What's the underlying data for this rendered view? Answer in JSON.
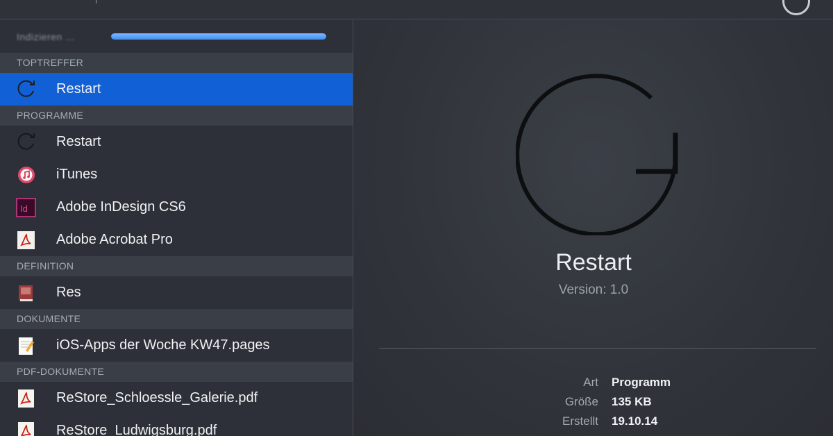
{
  "search": {
    "query": ""
  },
  "indexing": {
    "label": "Indizieren …",
    "progress_percent": 100
  },
  "sections": {
    "top_hits": "TOPTREFFER",
    "programs": "PROGRAMME",
    "definition": "DEFINITION",
    "documents": "DOKUMENTE",
    "pdf_documents": "PDF-DOKUMENTE"
  },
  "results": {
    "top_hit": {
      "label": "Restart",
      "icon": "restart-icon"
    },
    "programs": [
      {
        "label": "Restart",
        "icon": "restart-icon"
      },
      {
        "label": "iTunes",
        "icon": "itunes-icon"
      },
      {
        "label": "Adobe InDesign CS6",
        "icon": "indesign-icon"
      },
      {
        "label": "Adobe Acrobat Pro",
        "icon": "acrobat-icon"
      }
    ],
    "definition": [
      {
        "label": "Res",
        "icon": "dictionary-icon"
      }
    ],
    "documents": [
      {
        "label": "iOS-Apps der Woche KW47.pages",
        "icon": "pages-document-icon"
      }
    ],
    "pdf_documents": [
      {
        "label": "ReStore_Schloessle_Galerie.pdf",
        "icon": "pdf-icon"
      },
      {
        "label": "ReStore_Ludwigsburg.pdf",
        "icon": "pdf-icon"
      }
    ]
  },
  "detail": {
    "icon": "restart-icon",
    "name": "Restart",
    "version": "Version: 1.0",
    "meta": [
      {
        "key": "Art",
        "value": "Programm"
      },
      {
        "key": "Größe",
        "value": "135 KB"
      },
      {
        "key": "Erstellt",
        "value": "19.10.14"
      }
    ]
  },
  "colors": {
    "selection": "#1260d6",
    "progress": "#4a97f7",
    "background": "#2c2f36"
  }
}
